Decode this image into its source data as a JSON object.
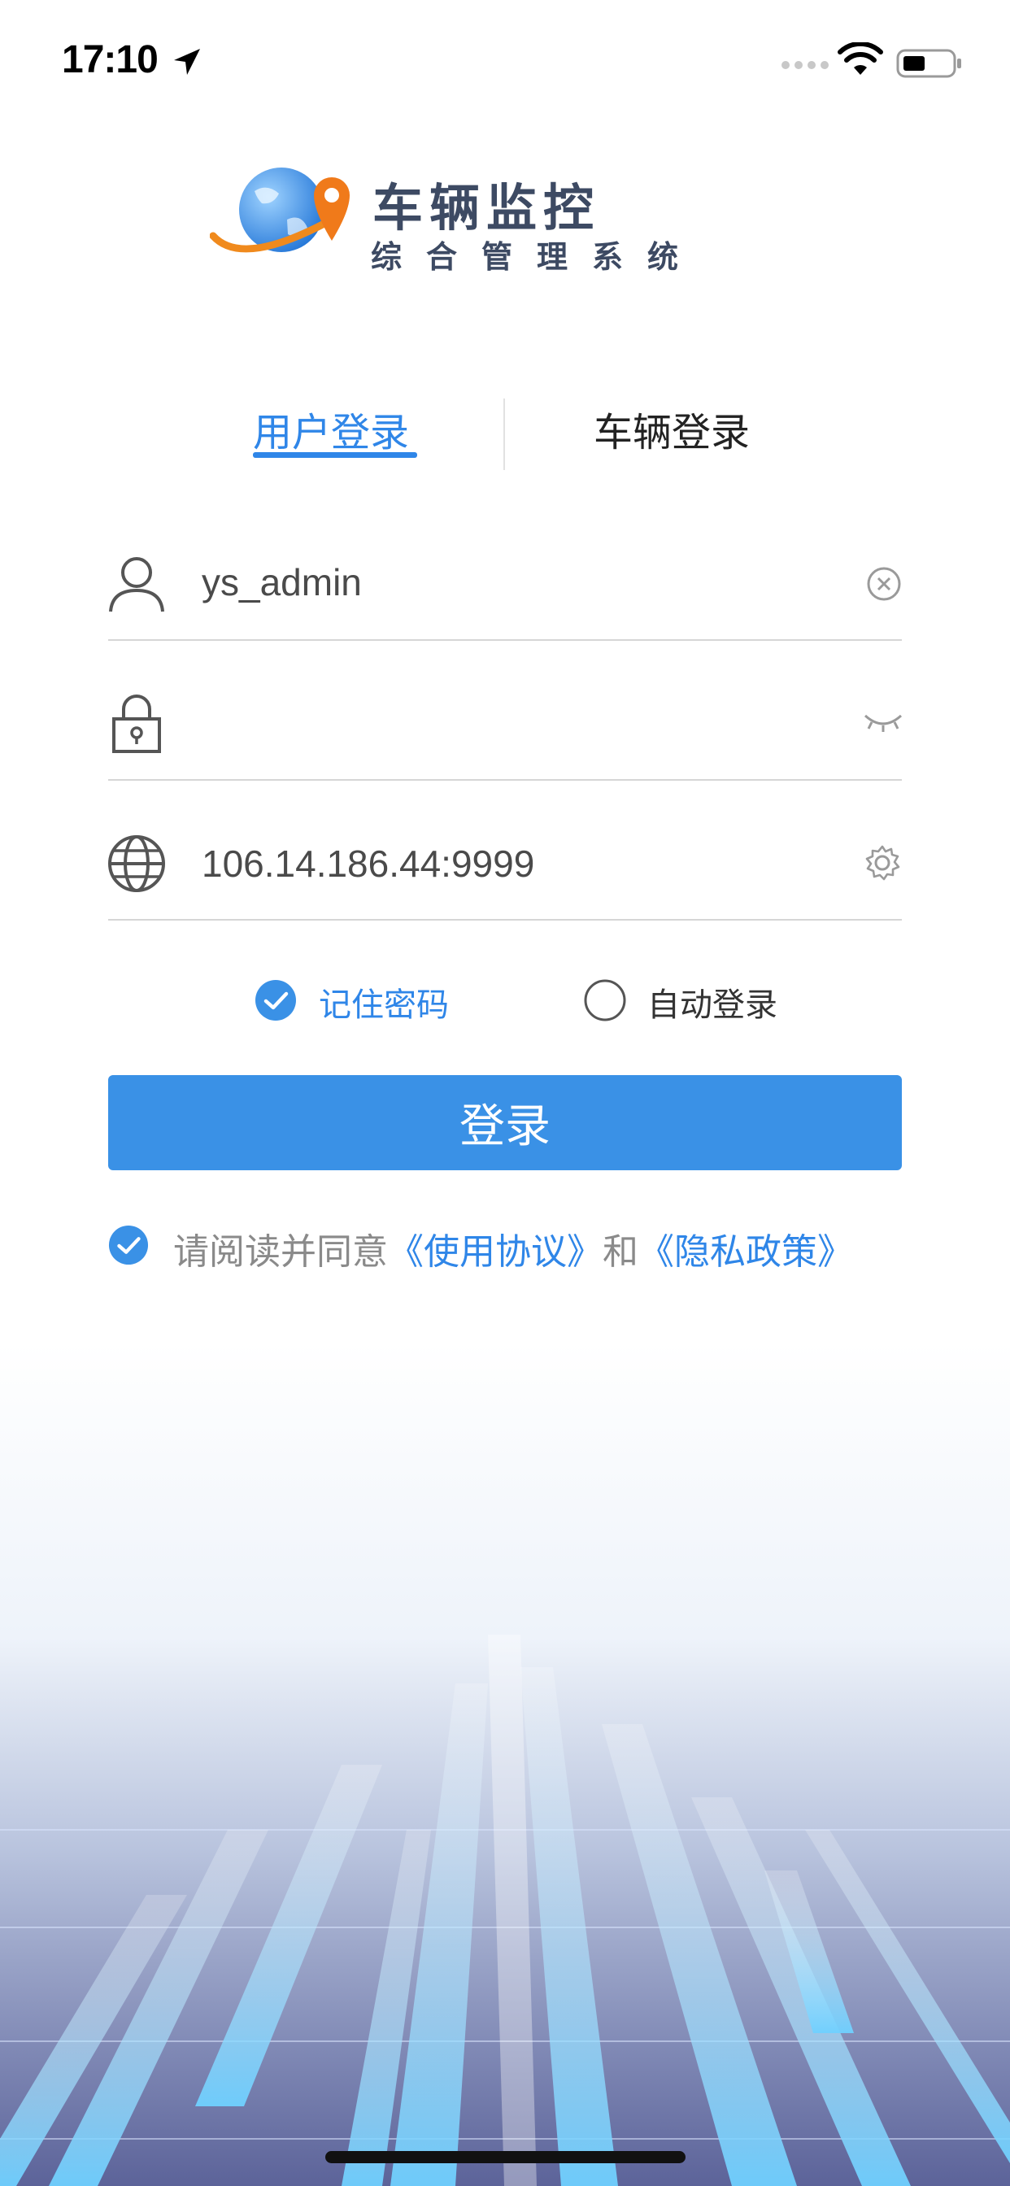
{
  "status_bar": {
    "time": "17:10"
  },
  "logo": {
    "title": "车辆监控",
    "subtitle": "综合管理系统"
  },
  "tabs": [
    {
      "label": "用户登录",
      "active": true
    },
    {
      "label": "车辆登录",
      "active": false
    }
  ],
  "form": {
    "username": {
      "value": "ys_admin",
      "placeholder": ""
    },
    "password": {
      "value": "",
      "placeholder": ""
    },
    "server": {
      "value": "106.14.186.44:9999",
      "placeholder": ""
    }
  },
  "options": {
    "remember_password": {
      "label": "记住密码",
      "checked": true
    },
    "auto_login": {
      "label": "自动登录",
      "checked": false
    }
  },
  "login_button": {
    "label": "登录"
  },
  "agreement": {
    "prefix": "请阅读并同意",
    "user_agreement": "《使用协议》",
    "conjunction": "和",
    "privacy_policy": "《隐私政策》",
    "checked": true
  },
  "colors": {
    "accent": "#2f86e8",
    "button": "#3a91e6",
    "logo_text": "#3d4a63"
  },
  "icons": {
    "status": [
      "location-arrow-icon",
      "signal-dots-icon",
      "wifi-icon",
      "battery-icon"
    ],
    "rows": [
      "user-icon",
      "lock-icon",
      "globe-icon"
    ],
    "actions": [
      "clear-icon",
      "eye-closed-icon",
      "gear-icon"
    ]
  }
}
